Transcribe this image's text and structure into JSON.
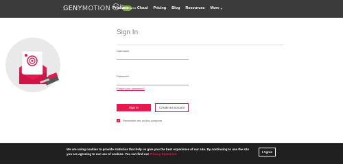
{
  "brand": {
    "logo_bold": "GENY",
    "logo_light": "MOTION",
    "badge": "3.0",
    "by": "by",
    "pill": "genymobile"
  },
  "nav": {
    "items": [
      {
        "label": "Products",
        "has_dropdown": true
      },
      {
        "label": "Cloud",
        "has_dropdown": false
      },
      {
        "label": "Pricing",
        "has_dropdown": false
      },
      {
        "label": "Blog",
        "has_dropdown": false
      },
      {
        "label": "Resources",
        "has_dropdown": false
      },
      {
        "label": "More",
        "has_dropdown": true
      }
    ],
    "chevron_icon": "chevron-down-icon"
  },
  "signin": {
    "title": "Sign In",
    "username_label": "Username",
    "username_value": "",
    "password_label": "Password",
    "password_value": "",
    "forgot_link": "Forgot your password?",
    "signin_button": "Sign In",
    "create_button": "Create an account",
    "remember_label": "Remember me on this computer",
    "remember_checked": true
  },
  "cookie": {
    "text_line1": "We are using cookies to provide statistics that help us give you the best experience of our site. By continuing to use the site you are",
    "text_line2_prefix": "agreeing to our use of cookies. You can find our",
    "privacy_link": "Privacy Statement",
    "agree_button": "I Agree"
  },
  "colors": {
    "accent": "#e5194e",
    "navbar_bg": "#3b3b3b",
    "cookie_bg": "#1e1e1e"
  }
}
